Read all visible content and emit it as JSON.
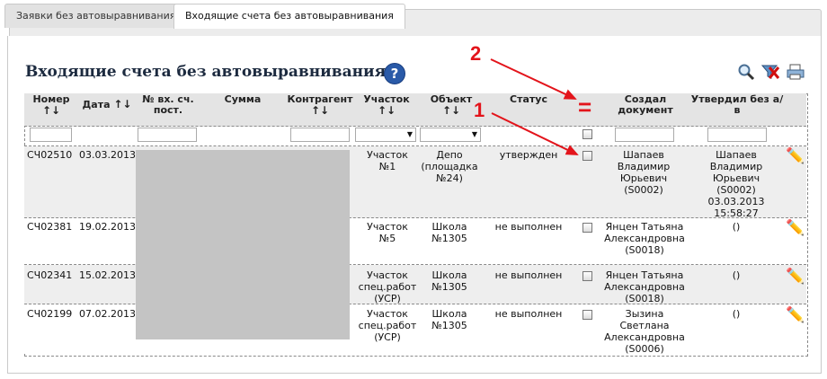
{
  "tabs": [
    {
      "label": "Заявки без автовыравнивания"
    },
    {
      "label": "Входящие счета без автовыравнивания"
    }
  ],
  "page_title": "Входящие счета без автовыравнивания",
  "help_icon": "?",
  "columns": {
    "number": "Номер",
    "date": "Дата",
    "supplier_invoice": "№ вх. сч. пост.",
    "sum": "Сумма",
    "contractor": "Контрагент",
    "site": "Участок",
    "object": "Объект",
    "status": "Статус",
    "created_by": "Создал документ",
    "approved_by": "Утвердил без а/в"
  },
  "sort_arrows": "↑↓",
  "annotations": {
    "one": "1",
    "two": "2",
    "equals": "="
  },
  "rows": [
    {
      "number": "СЧ02510",
      "date": "03.03.2013",
      "site": "Участок №1",
      "object": "Депо (площадка №24)",
      "status": "утвержден",
      "created_by": "Шапаев Владимир Юрьевич (S0002)",
      "approved_by": "Шапаев Владимир Юрьевич (S0002) 03.03.2013 15:58:27"
    },
    {
      "number": "СЧ02381",
      "date": "19.02.2013",
      "site": "Участок №5",
      "object": "Школа №1305",
      "status": "не выполнен",
      "created_by": "Янцен Татьяна Александровна (S0018)",
      "approved_by": "()"
    },
    {
      "number": "СЧ02341",
      "date": "15.02.2013",
      "site": "Участок спец.работ (УСР)",
      "object": "Школа №1305",
      "status": "не выполнен",
      "created_by": "Янцен Татьяна Александровна (S0018)",
      "approved_by": "()"
    },
    {
      "number": "СЧ02199",
      "date": "07.02.2013",
      "site": "Участок спец.работ (УСР)",
      "object": "Школа №1305",
      "status": "не выполнен",
      "created_by": "Зызина Светлана Александровна (S0006)",
      "approved_by": "()"
    }
  ]
}
